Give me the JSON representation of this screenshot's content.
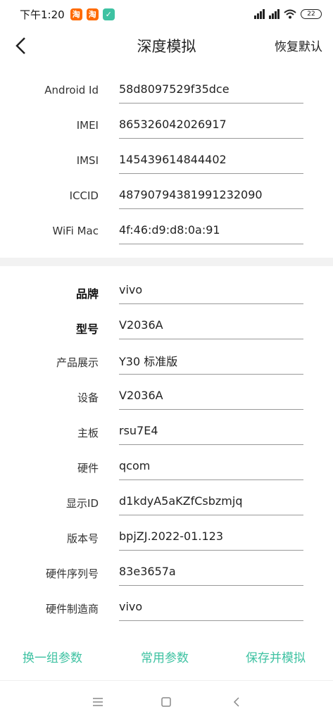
{
  "status_bar": {
    "time": "下午1:20",
    "battery": "22"
  },
  "header": {
    "title": "深度模拟",
    "restore_label": "恢复默认"
  },
  "identifiers": [
    {
      "label": "Android Id",
      "value": "58d8097529f35dce"
    },
    {
      "label": "IMEI",
      "value": "865326042026917"
    },
    {
      "label": "IMSI",
      "value": "145439614844402"
    },
    {
      "label": "ICCID",
      "value": "48790794381991232090"
    },
    {
      "label": "WiFi Mac",
      "value": "4f:46:d9:d8:0a:91"
    }
  ],
  "device": [
    {
      "label": "品牌",
      "value": "vivo"
    },
    {
      "label": "型号",
      "value": "V2036A"
    },
    {
      "label": "产品展示",
      "value": "Y30 标准版"
    },
    {
      "label": "设备",
      "value": "V2036A"
    },
    {
      "label": "主板",
      "value": "rsu7E4"
    },
    {
      "label": "硬件",
      "value": "qcom"
    },
    {
      "label": "显示ID",
      "value": "d1kdyA5aKZfCsbzmjq"
    },
    {
      "label": "版本号",
      "value": "bpjZJ.2022-01.123"
    },
    {
      "label": "硬件序列号",
      "value": "83e3657a"
    },
    {
      "label": "硬件制造商",
      "value": "vivo"
    }
  ],
  "actions": {
    "swap": "换一组参数",
    "common": "常用参数",
    "save": "保存并模拟"
  },
  "colors": {
    "accent": "#3ec2a2",
    "divider": "#f2f2f2",
    "underline": "#999999"
  }
}
